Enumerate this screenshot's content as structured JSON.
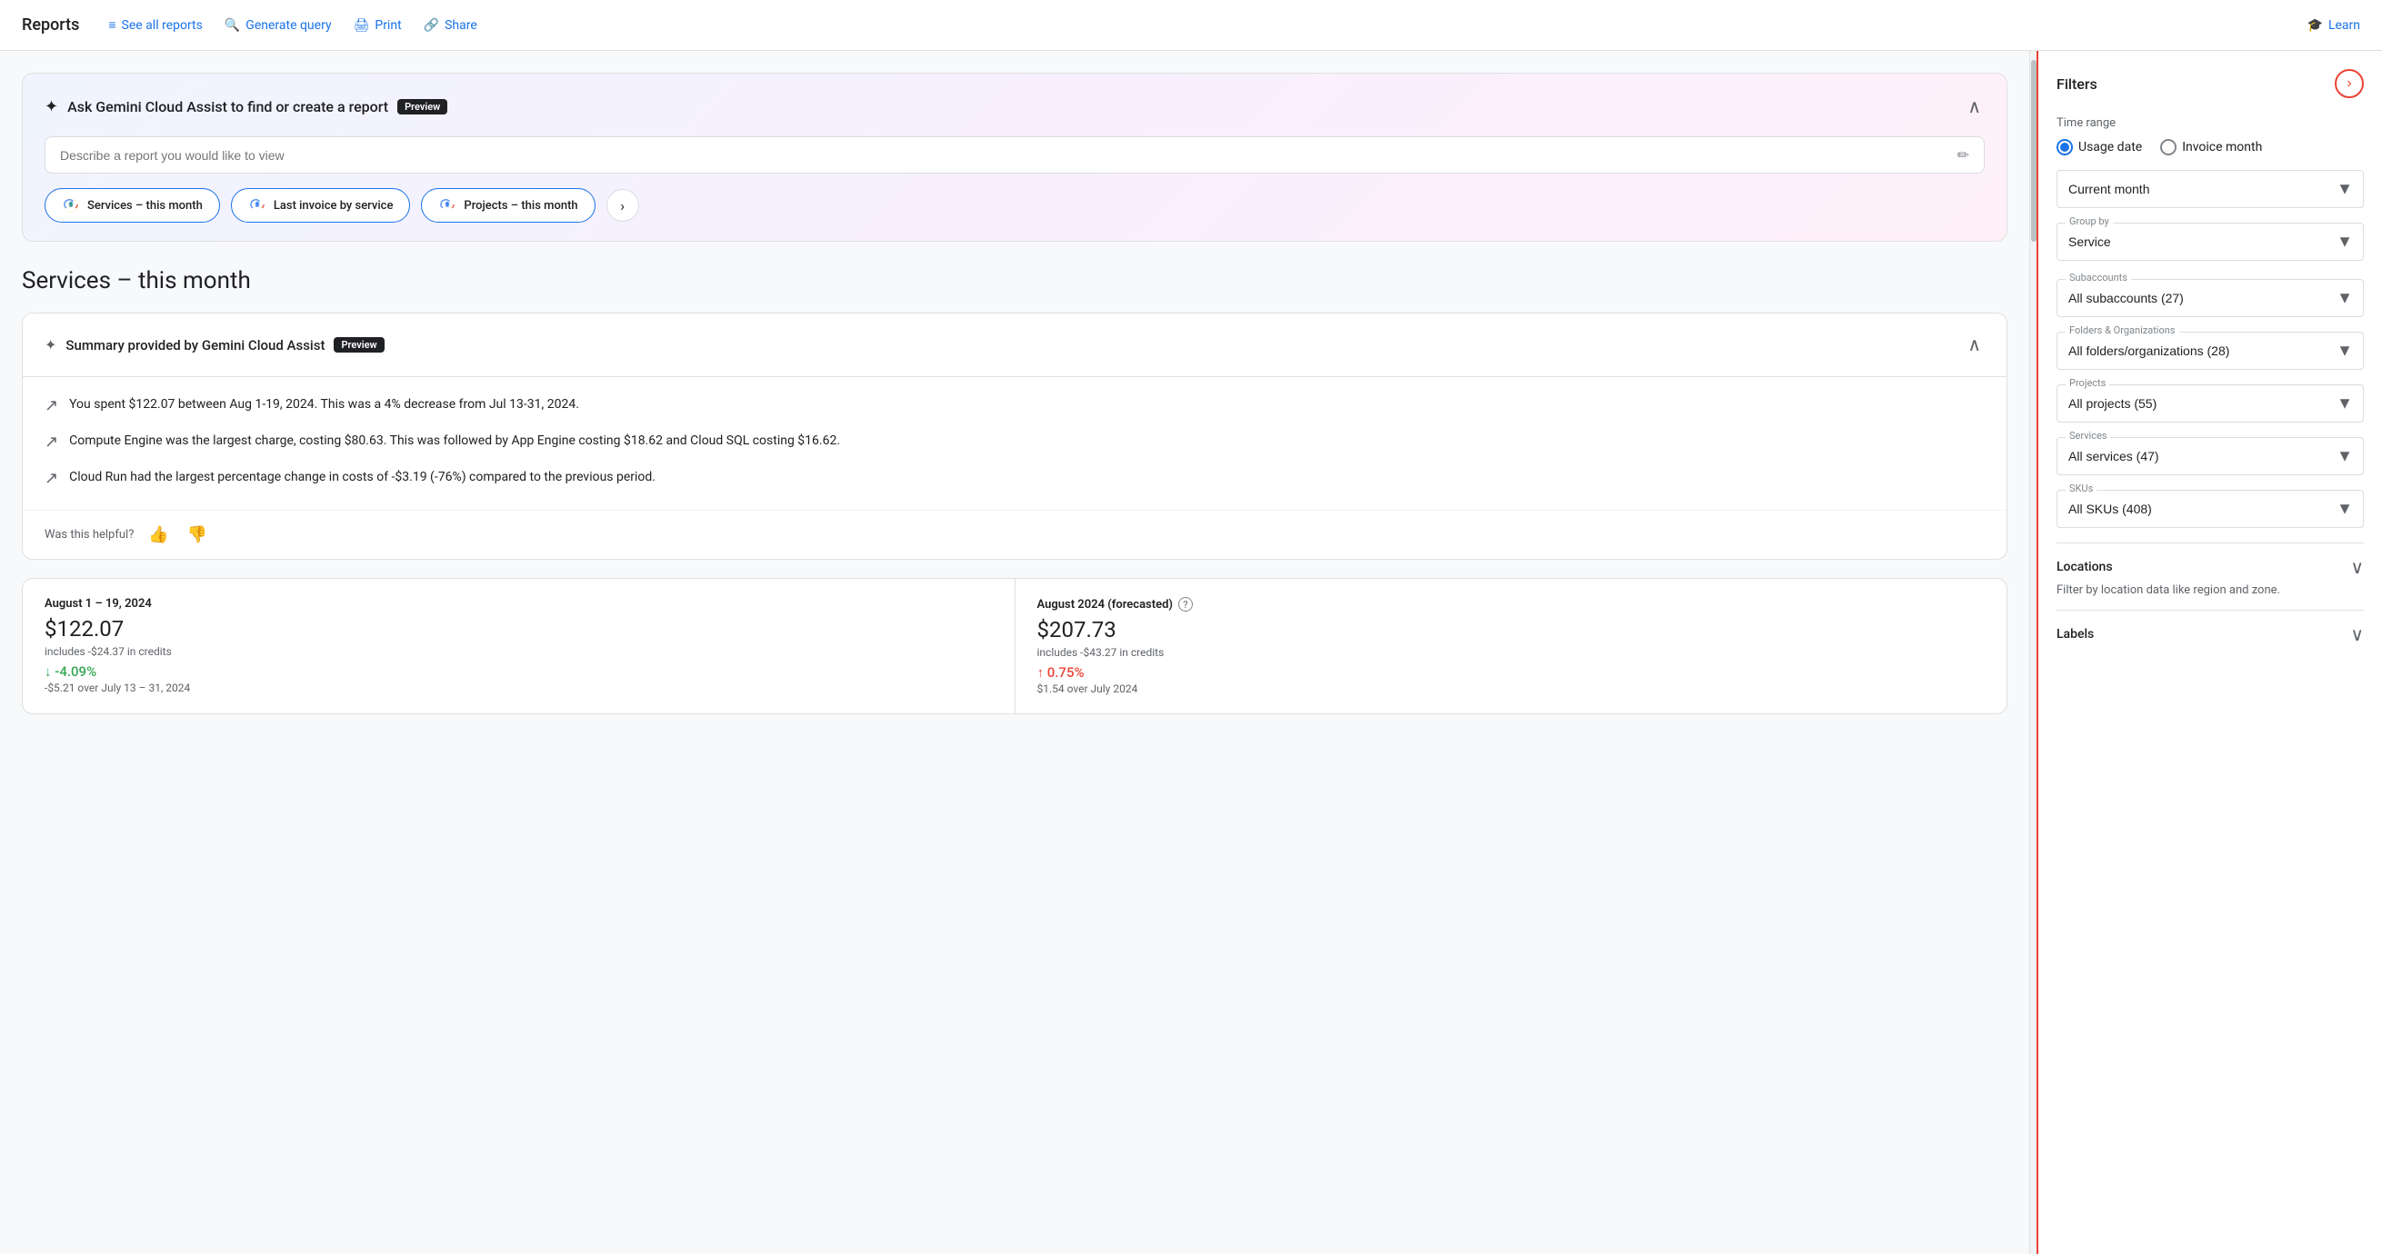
{
  "header": {
    "title": "Reports",
    "nav_links": [
      {
        "id": "see-all-reports",
        "label": "See all reports",
        "icon": "list"
      },
      {
        "id": "generate-query",
        "label": "Generate query",
        "icon": "search"
      },
      {
        "id": "print",
        "label": "Print",
        "icon": "print"
      },
      {
        "id": "share",
        "label": "Share",
        "icon": "link"
      }
    ],
    "learn_label": "Learn"
  },
  "gemini_banner": {
    "title": "Ask Gemini Cloud Assist to find or create a report",
    "preview_badge": "Preview",
    "input_placeholder": "Describe a report you would like to view",
    "chips": [
      {
        "id": "chip-services",
        "label": "Services – this month"
      },
      {
        "id": "chip-last-invoice",
        "label": "Last invoice by service"
      },
      {
        "id": "chip-projects",
        "label": "Projects – this month"
      }
    ]
  },
  "page_title": "Services – this month",
  "summary_card": {
    "title": "Summary provided by Gemini Cloud Assist",
    "preview_badge": "Preview",
    "items": [
      "You spent $122.07 between Aug 1-19, 2024. This was a 4% decrease from Jul 13-31, 2024.",
      "Compute Engine was the largest charge, costing $80.63. This was followed by App Engine costing $18.62 and Cloud SQL costing $16.62.",
      "Cloud Run had the largest percentage change in costs of -$3.19 (-76%) compared to the previous period."
    ],
    "feedback_label": "Was this helpful?"
  },
  "stats": {
    "left": {
      "date_range": "August 1 – 19, 2024",
      "amount": "$122.07",
      "credits": "includes -$24.37 in credits",
      "change": "↓ -4.09%",
      "change_type": "down",
      "change_detail": "-$5.21 over July 13 – 31, 2024"
    },
    "right": {
      "date_range": "August 2024 (forecasted)",
      "amount": "$207.73",
      "credits": "includes -$43.27 in credits",
      "change": "↑ 0.75%",
      "change_type": "up",
      "change_detail": "$1.54 over July 2024"
    }
  },
  "filters": {
    "title": "Filters",
    "time_range_label": "Time range",
    "radio_options": [
      {
        "id": "usage-date",
        "label": "Usage date",
        "selected": true
      },
      {
        "id": "invoice-month",
        "label": "Invoice month",
        "selected": false
      }
    ],
    "dropdowns": [
      {
        "id": "time-period",
        "label": "",
        "value": "Current month"
      },
      {
        "id": "group-by",
        "label": "Group by",
        "value": "Service"
      },
      {
        "id": "subaccounts",
        "label": "Subaccounts",
        "value": "All subaccounts (27)"
      },
      {
        "id": "folders-orgs",
        "label": "Folders & Organizations",
        "value": "All folders/organizations (28)"
      },
      {
        "id": "projects",
        "label": "Projects",
        "value": "All projects (55)"
      },
      {
        "id": "services",
        "label": "Services",
        "value": "All services (47)"
      },
      {
        "id": "skus",
        "label": "SKUs",
        "value": "All SKUs (408)"
      }
    ],
    "collapsibles": [
      {
        "id": "locations",
        "label": "Locations",
        "desc": "Filter by location data like region and zone."
      },
      {
        "id": "labels",
        "label": "Labels",
        "desc": ""
      }
    ]
  }
}
